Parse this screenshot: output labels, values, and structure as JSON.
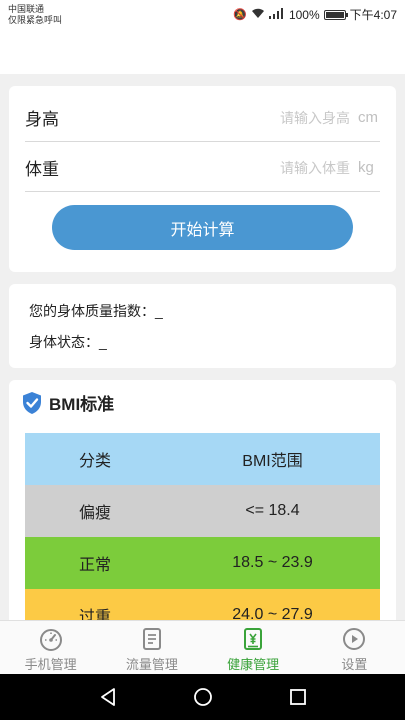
{
  "status_bar": {
    "carrier_line1": "中国联通",
    "carrier_line2": "仅限紧急呼叫",
    "battery": "100%",
    "time": "下午4:07",
    "battery_level": 1.0
  },
  "form": {
    "height_label": "身高",
    "height_placeholder": "请输入身高",
    "height_unit": "cm",
    "weight_label": "体重",
    "weight_placeholder": "请输入体重",
    "weight_unit": "kg",
    "calc_button": "开始计算"
  },
  "result": {
    "bmi_label": "您的身体质量指数：",
    "bmi_value": "_",
    "state_label": "身体状态：",
    "state_value": "_"
  },
  "standard": {
    "title": "BMI标准",
    "header": {
      "category": "分类",
      "range": "BMI范围",
      "color": "#a6d8f5"
    },
    "rows": [
      {
        "category": "偏瘦",
        "range": "<= 18.4",
        "color": "#cfcfcf"
      },
      {
        "category": "正常",
        "range": "18.5 ~ 23.9",
        "color": "#7ccc3b"
      },
      {
        "category": "过重",
        "range": "24.0 ~ 27.9",
        "color": "#fcca45"
      }
    ]
  },
  "tabs": [
    {
      "label": "手机管理",
      "icon": "gauge-icon",
      "active": false
    },
    {
      "label": "流量管理",
      "icon": "document-icon",
      "active": false
    },
    {
      "label": "健康管理",
      "icon": "yen-document-icon",
      "active": true
    },
    {
      "label": "设置",
      "icon": "play-circle-icon",
      "active": false
    }
  ],
  "colors": {
    "accent_blue": "#4a97d2",
    "active_green": "#3aa33a",
    "inactive_gray": "#8a8a8a"
  }
}
